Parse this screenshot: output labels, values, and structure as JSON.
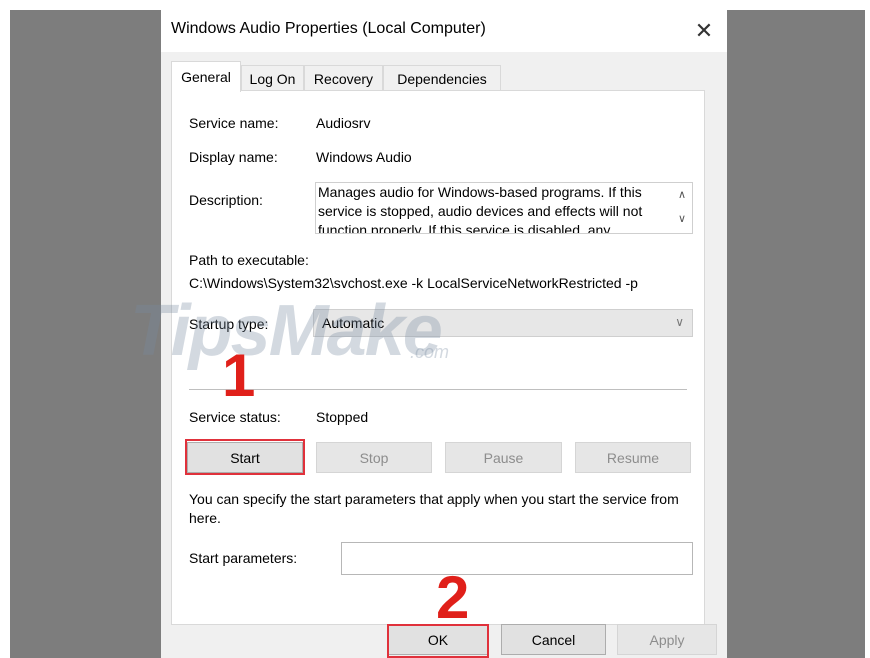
{
  "window": {
    "title": "Windows Audio Properties (Local Computer)",
    "close_glyph": "✕"
  },
  "tabs": [
    {
      "label": "General",
      "active": true
    },
    {
      "label": "Log On",
      "active": false
    },
    {
      "label": "Recovery",
      "active": false
    },
    {
      "label": "Dependencies",
      "active": false
    }
  ],
  "general": {
    "service_name_label": "Service name:",
    "service_name_value": "Audiosrv",
    "display_name_label": "Display name:",
    "display_name_value": "Windows Audio",
    "description_label": "Description:",
    "description_value": "Manages audio for Windows-based programs.  If this service is stopped, audio devices and effects will not function properly.  If this service is disabled, any",
    "path_label": "Path to executable:",
    "path_value": "C:\\Windows\\System32\\svchost.exe -k LocalServiceNetworkRestricted -p",
    "startup_type_label": "Startup type:",
    "startup_type_value": "Automatic",
    "service_status_label": "Service status:",
    "service_status_value": "Stopped",
    "start_params_text": "You can specify the start parameters that apply when you start the service from here.",
    "start_params_label": "Start parameters:",
    "start_params_value": ""
  },
  "service_buttons": {
    "start": "Start",
    "stop": "Stop",
    "pause": "Pause",
    "resume": "Resume"
  },
  "dialog_buttons": {
    "ok": "OK",
    "cancel": "Cancel",
    "apply": "Apply"
  },
  "annotations": {
    "step1": "1",
    "step2": "2",
    "highlight_color": "#e0313b",
    "number_color": "#e0201a"
  },
  "watermark": {
    "text": "TipsMake",
    "suffix": ".com"
  }
}
